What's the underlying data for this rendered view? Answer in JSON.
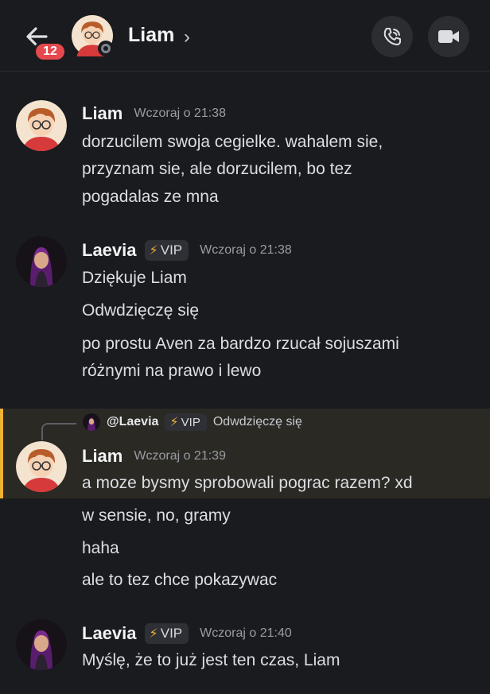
{
  "header": {
    "title": "Liam",
    "chevron": "›",
    "unread_count": "12",
    "back_icon": "arrow-left-icon",
    "call_icon": "phone-call-icon",
    "video_icon": "video-camera-icon"
  },
  "badge_label": "VIP",
  "badge_icon": "lightning-bolt-icon",
  "colors": {
    "background": "#1a1b1f",
    "unread_badge": "#e5484d",
    "highlight_border": "#f0b232",
    "vip_bolt": "#f0b232"
  },
  "messages": [
    {
      "author": "Liam",
      "timestamp": "Wczoraj o 21:38",
      "lines": [
        "dorzucilem swoja cegielke. wahalem sie,",
        "przyznam sie, ale dorzucilem, bo tez",
        "pogadalas ze mna"
      ]
    },
    {
      "author": "Laevia",
      "timestamp": "Wczoraj o 21:38",
      "lines": [
        "Dziękuje Liam",
        "Odwdzięczę się",
        "po prostu Aven za bardzo rzucał sojuszami",
        "różnymi na prawo i lewo"
      ]
    },
    {
      "author": "Liam",
      "timestamp": "Wczoraj o 21:39",
      "reply": {
        "author": "@Laevia",
        "preview": "Odwdzięczę się"
      },
      "lines": [
        "a moze bysmy sprobowali pograc razem? xd",
        "w sensie, no, gramy",
        "haha",
        "ale to tez chce pokazywac"
      ]
    },
    {
      "author": "Laevia",
      "timestamp": "Wczoraj o 21:40",
      "lines": [
        "Myślę, że to już jest ten czas, Liam"
      ]
    }
  ]
}
